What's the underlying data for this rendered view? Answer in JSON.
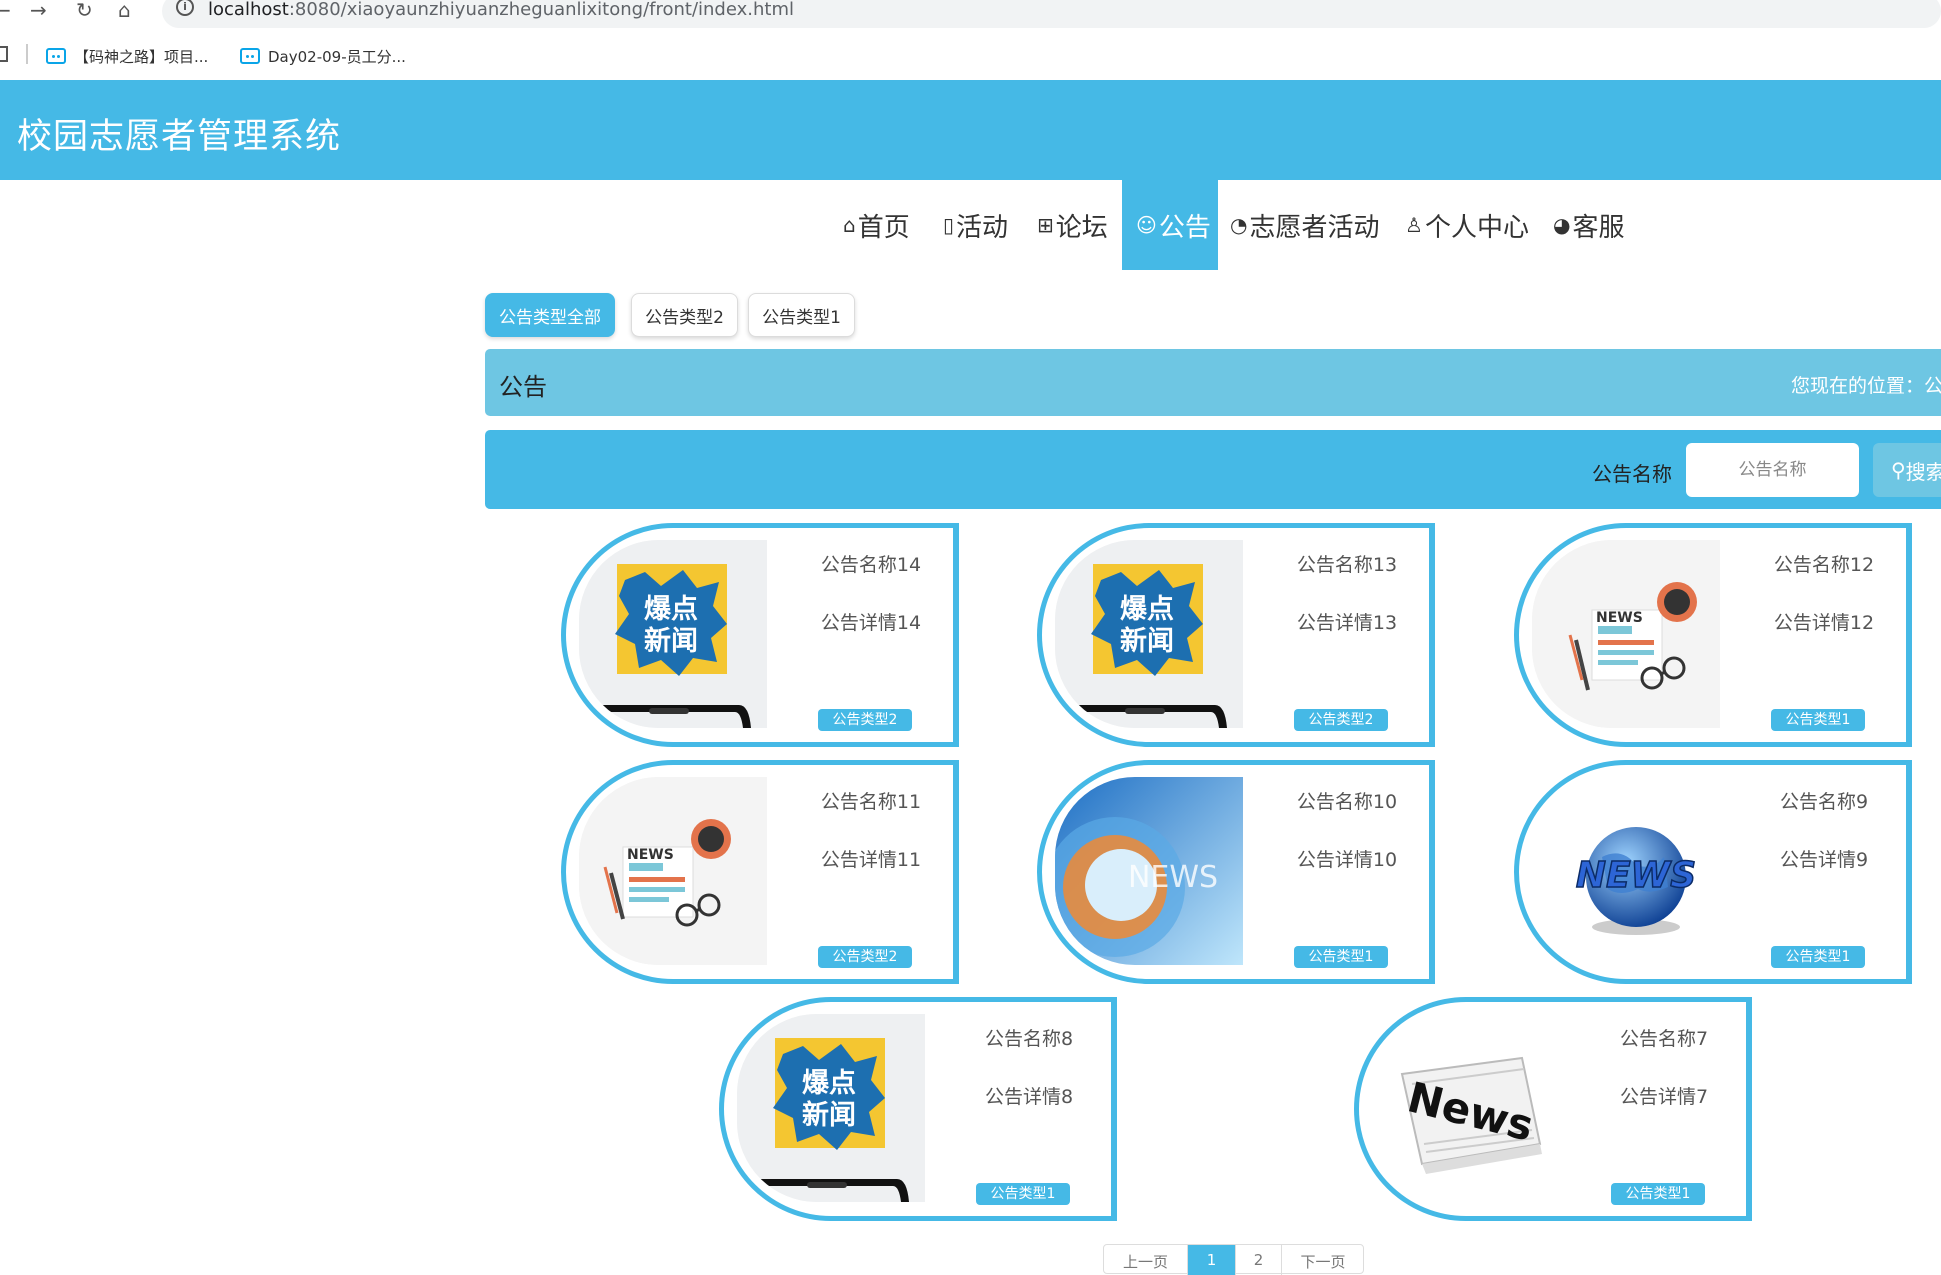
{
  "browser": {
    "back_glyph": "←",
    "forward_glyph": "→",
    "reload_glyph": "↻",
    "home_glyph": "⌂",
    "url_host": "localhost",
    "url_path": ":8080/xiaoyaunzhiyuanzheguanlixitong/front/index.html",
    "bookmarks": [
      "【码神之路】项目...",
      "Day02-09-员工分..."
    ]
  },
  "site": {
    "title": "校园志愿者管理系统"
  },
  "nav": {
    "items": [
      {
        "icon": "⌂",
        "label": "首页"
      },
      {
        "icon": "▯",
        "label": "活动"
      },
      {
        "icon": "⊞",
        "label": "论坛"
      },
      {
        "icon": "☺",
        "label": "公告"
      },
      {
        "icon": "◔",
        "label": "志愿者活动"
      },
      {
        "icon": "♙",
        "label": "个人中心"
      },
      {
        "icon": "◕",
        "label": "客服"
      }
    ]
  },
  "types": [
    "公告类型全部",
    "公告类型2",
    "公告类型1"
  ],
  "position": {
    "title": "公告",
    "crumb": "您现在的位置：公"
  },
  "search": {
    "label": "公告名称",
    "placeholder": "公告名称",
    "button": "搜索"
  },
  "cards": [
    {
      "name": "公告名称14",
      "detail": "公告详情14",
      "type": "公告类型2",
      "image": "baodian"
    },
    {
      "name": "公告名称13",
      "detail": "公告详情13",
      "type": "公告类型2",
      "image": "baodian"
    },
    {
      "name": "公告名称12",
      "detail": "公告详情12",
      "type": "公告类型1",
      "image": "news-paper"
    },
    {
      "name": "公告名称11",
      "detail": "公告详情11",
      "type": "公告类型2",
      "image": "news-paper"
    },
    {
      "name": "公告名称10",
      "detail": "公告详情10",
      "type": "公告类型1",
      "image": "news-tv"
    },
    {
      "name": "公告名称9",
      "detail": "公告详情9",
      "type": "公告类型1",
      "image": "news-globe"
    },
    {
      "name": "公告名称8",
      "detail": "公告详情8",
      "type": "公告类型1",
      "image": "baodian"
    },
    {
      "name": "公告名称7",
      "detail": "公告详情7",
      "type": "公告类型1",
      "image": "news-print"
    }
  ],
  "image_text": {
    "baodian_1": "爆点",
    "baodian_2": "新闻",
    "news": "NEWS",
    "news_print": "News"
  },
  "pager": {
    "prev": "上一页",
    "pages": [
      "1",
      "2"
    ],
    "next": "下一页"
  },
  "colors": {
    "primary": "#45b9e6",
    "light": "#6ec6e3",
    "badge_yellow": "#f4c631"
  }
}
